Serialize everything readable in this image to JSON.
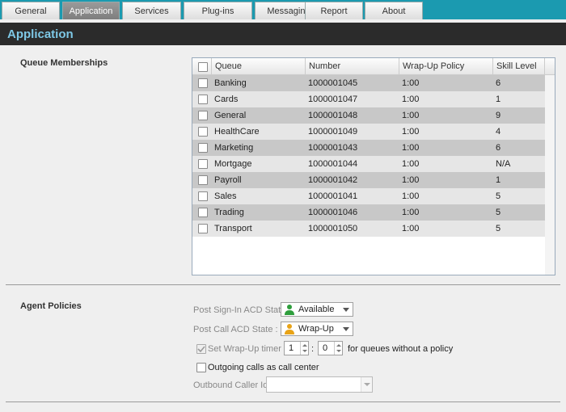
{
  "tabs": [
    {
      "label": "General",
      "active": false
    },
    {
      "label": "Application",
      "active": true
    },
    {
      "label": "Services",
      "active": false
    },
    {
      "label": "Plug-ins",
      "active": false
    },
    {
      "label": "Messaging",
      "active": false
    },
    {
      "label": "Report",
      "active": false
    },
    {
      "label": "About",
      "active": false
    }
  ],
  "header": {
    "title": "Application"
  },
  "queue_section": {
    "label": "Queue Memberships",
    "columns": [
      "Queue",
      "Number",
      "Wrap-Up Policy",
      "Skill Level"
    ],
    "rows": [
      {
        "queue": "Banking",
        "number": "1000001045",
        "wrapup": "1:00",
        "skill": "6"
      },
      {
        "queue": "Cards",
        "number": "1000001047",
        "wrapup": "1:00",
        "skill": "1"
      },
      {
        "queue": "General",
        "number": "1000001048",
        "wrapup": "1:00",
        "skill": "9"
      },
      {
        "queue": "HealthCare",
        "number": "1000001049",
        "wrapup": "1:00",
        "skill": "4"
      },
      {
        "queue": "Marketing",
        "number": "1000001043",
        "wrapup": "1:00",
        "skill": "6"
      },
      {
        "queue": "Mortgage",
        "number": "1000001044",
        "wrapup": "1:00",
        "skill": "N/A"
      },
      {
        "queue": "Payroll",
        "number": "1000001042",
        "wrapup": "1:00",
        "skill": "1"
      },
      {
        "queue": "Sales",
        "number": "1000001041",
        "wrapup": "1:00",
        "skill": "5"
      },
      {
        "queue": "Trading",
        "number": "1000001046",
        "wrapup": "1:00",
        "skill": "5"
      },
      {
        "queue": "Transport",
        "number": "1000001050",
        "wrapup": "1:00",
        "skill": "5"
      }
    ]
  },
  "agent_policies": {
    "label": "Agent Policies",
    "post_signin_label": "Post Sign-In ACD State :",
    "post_signin_value": "Available",
    "post_call_label": "Post Call ACD State :",
    "post_call_value": "Wrap-Up",
    "wrapup_timer_label": "Set Wrap-Up timer to",
    "wrapup_minutes": "1",
    "wrapup_separator": ":",
    "wrapup_seconds": "0",
    "wrapup_suffix": "for queues without a policy",
    "outgoing_label": "Outgoing calls as call center",
    "outbound_caller_label": "Outbound Caller Id :",
    "outbound_caller_value": ""
  },
  "colors": {
    "tabbar": "#1b9ab0",
    "header_bg": "#2b2b2b",
    "header_text": "#7ec8e6",
    "available_icon": "#2e9e3c",
    "wrapup_icon": "#e8a317"
  }
}
